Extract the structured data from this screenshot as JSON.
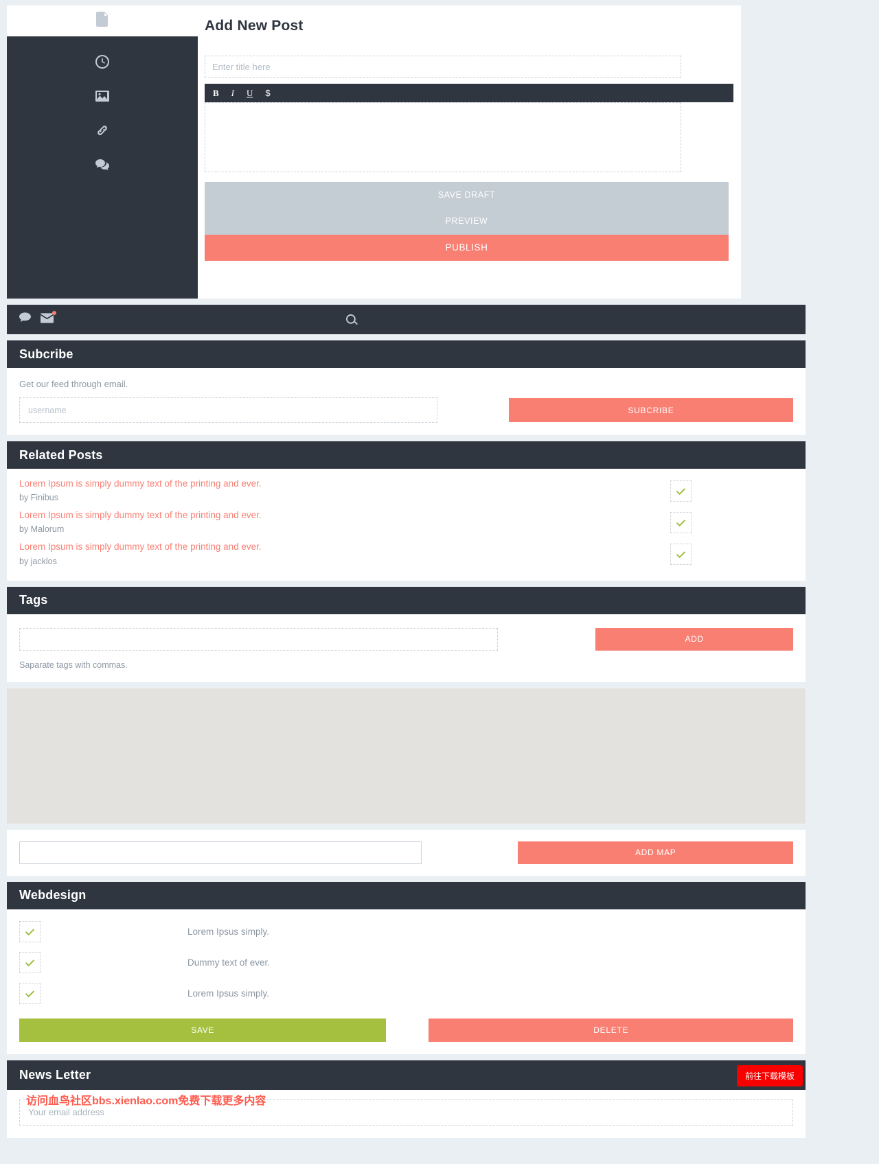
{
  "editor": {
    "doc_icon": "document-icon",
    "title": "Add New Post",
    "title_placeholder": "Enter title here",
    "sidebar_icons": [
      "clock-icon",
      "image-icon",
      "link-icon",
      "comment-icon"
    ],
    "toolbar": {
      "bold": "B",
      "italic": "I",
      "underline": "U",
      "dollar": "$"
    },
    "buttons": {
      "save_draft": "SAVE DRAFT",
      "preview": "PREVIEW",
      "publish": "PUBLISH"
    }
  },
  "utility_bar": {
    "comment_icon": "comment-icon",
    "mail_icon": "mail-icon",
    "search_icon": "search-icon",
    "has_notification": true,
    "notification_color": "#f97f73"
  },
  "subscribe": {
    "heading": "Subcribe",
    "hint": "Get our feed through email.",
    "input_placeholder": "username",
    "button_label": "SUBCRIBE"
  },
  "related_posts": {
    "heading": "Related Posts",
    "items": [
      {
        "title": "Lorem Ipsum is simply dummy text of the printing and ever.",
        "author": "by Finibus",
        "checked": true
      },
      {
        "title": "Lorem Ipsum is simply dummy text of the printing and ever.",
        "author": "by Malorum",
        "checked": true
      },
      {
        "title": "Lorem Ipsum is simply dummy text of the printing and ever.",
        "author": "by jacklos",
        "checked": true
      }
    ]
  },
  "tags": {
    "heading": "Tags",
    "input_value": "",
    "button_label": "ADD",
    "hint": "Saparate tags with commas."
  },
  "map": {
    "input_value": "",
    "button_label": "ADD MAP"
  },
  "webdesign": {
    "heading": "Webdesign",
    "items": [
      {
        "label": "Lorem Ipsus simply.",
        "checked": true
      },
      {
        "label": "Dummy text of ever.",
        "checked": true
      },
      {
        "label": "Lorem Ipsus simply.",
        "checked": true
      }
    ],
    "save_label": "SAVE",
    "delete_label": "DELETE"
  },
  "newsletter": {
    "heading": "News Letter",
    "badge_label": "前往下载模板",
    "input_placeholder": "Your email address",
    "watermark": "访问血鸟社区bbs.xienlao.com免费下载更多内容"
  },
  "colors": {
    "dark": "#2f3640",
    "accent_red": "#f97f73",
    "accent_green": "#a5bf3f",
    "grey_btn": "#c4ccd4",
    "page_bg": "#eaeff3",
    "badge_red": "#f80000"
  }
}
